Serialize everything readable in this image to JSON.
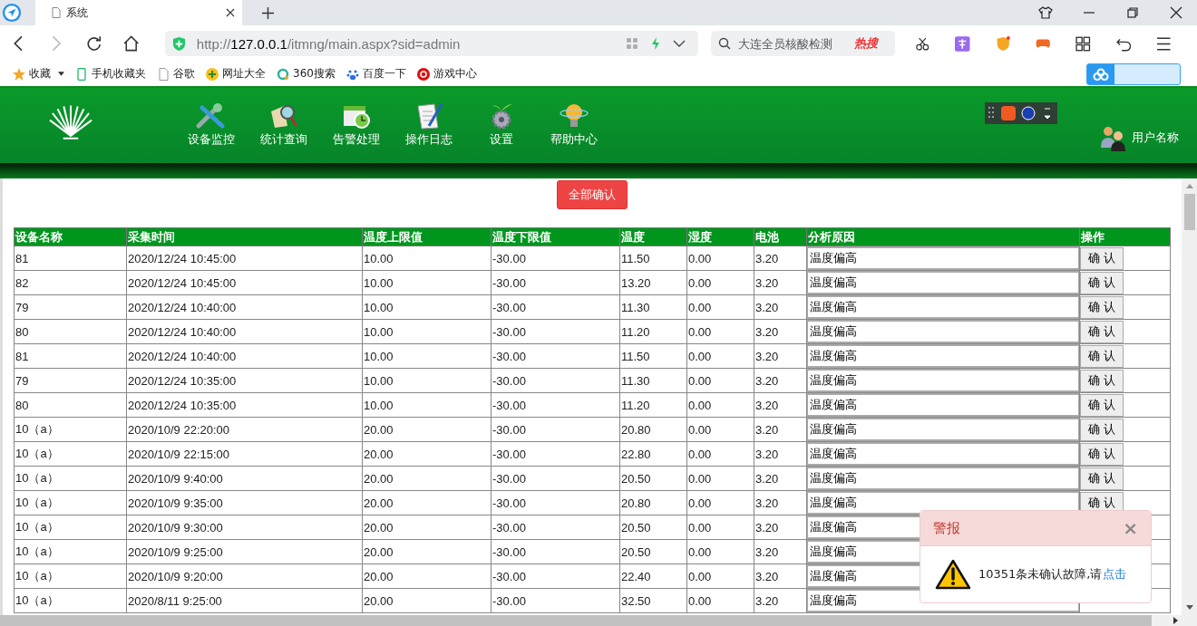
{
  "browser": {
    "tab_title": "系统",
    "url_prefix": "http://",
    "url_host": "127.0.0.1",
    "url_path": "/itmng/main.aspx?sid=admin",
    "search_placeholder": "大连全员核酸检测",
    "hot_label": "热搜",
    "bookmarks": [
      {
        "label": "收藏",
        "kind": "star"
      },
      {
        "label": "手机收藏夹",
        "kind": "phone"
      },
      {
        "label": "谷歌",
        "kind": "page"
      },
      {
        "label": "网址大全",
        "kind": "plus"
      },
      {
        "label": "360搜索",
        "kind": "ring"
      },
      {
        "label": "百度一下",
        "kind": "paw"
      },
      {
        "label": "游戏中心",
        "kind": "game"
      }
    ]
  },
  "header": {
    "nav": [
      {
        "label": "设备监控",
        "kind": "tools"
      },
      {
        "label": "统计查询",
        "kind": "magnifier"
      },
      {
        "label": "告警处理",
        "kind": "calendar"
      },
      {
        "label": "操作日志",
        "kind": "notes"
      },
      {
        "label": "设置",
        "kind": "gear"
      },
      {
        "label": "帮助中心",
        "kind": "bulb"
      }
    ],
    "user": "用户名称"
  },
  "confirm_all": "全部确认",
  "table": {
    "columns": [
      "设备名称",
      "采集时间",
      "温度上限值",
      "温度下限值",
      "温度",
      "湿度",
      "电池",
      "分析原因",
      "操作"
    ],
    "rows": [
      {
        "cells": [
          "81",
          "2020/12/24 10:45:00",
          "10.00",
          "-30.00",
          "11.50",
          "0.00",
          "3.20"
        ],
        "reason": "温度偏高",
        "action": "确 认"
      },
      {
        "cells": [
          "82",
          "2020/12/24 10:45:00",
          "10.00",
          "-30.00",
          "13.20",
          "0.00",
          "3.20"
        ],
        "reason": "温度偏高",
        "action": "确 认"
      },
      {
        "cells": [
          "79",
          "2020/12/24 10:40:00",
          "10.00",
          "-30.00",
          "11.30",
          "0.00",
          "3.20"
        ],
        "reason": "温度偏高",
        "action": "确 认"
      },
      {
        "cells": [
          "80",
          "2020/12/24 10:40:00",
          "10.00",
          "-30.00",
          "11.20",
          "0.00",
          "3.20"
        ],
        "reason": "温度偏高",
        "action": "确 认"
      },
      {
        "cells": [
          "81",
          "2020/12/24 10:40:00",
          "10.00",
          "-30.00",
          "11.50",
          "0.00",
          "3.20"
        ],
        "reason": "温度偏高",
        "action": "确 认"
      },
      {
        "cells": [
          "79",
          "2020/12/24 10:35:00",
          "10.00",
          "-30.00",
          "11.30",
          "0.00",
          "3.20"
        ],
        "reason": "温度偏高",
        "action": "确 认"
      },
      {
        "cells": [
          "80",
          "2020/12/24 10:35:00",
          "10.00",
          "-30.00",
          "11.20",
          "0.00",
          "3.20"
        ],
        "reason": "温度偏高",
        "action": "确 认"
      },
      {
        "cells": [
          "10（a）",
          "2020/10/9 22:20:00",
          "20.00",
          "-30.00",
          "20.80",
          "0.00",
          "3.20"
        ],
        "reason": "温度偏高",
        "action": "确 认"
      },
      {
        "cells": [
          "10（a）",
          "2020/10/9 22:15:00",
          "20.00",
          "-30.00",
          "22.80",
          "0.00",
          "3.20"
        ],
        "reason": "温度偏高",
        "action": "确 认"
      },
      {
        "cells": [
          "10（a）",
          "2020/10/9 9:40:00",
          "20.00",
          "-30.00",
          "20.50",
          "0.00",
          "3.20"
        ],
        "reason": "温度偏高",
        "action": "确 认"
      },
      {
        "cells": [
          "10（a）",
          "2020/10/9 9:35:00",
          "20.00",
          "-30.00",
          "20.80",
          "0.00",
          "3.20"
        ],
        "reason": "温度偏高",
        "action": "确 认"
      },
      {
        "cells": [
          "10（a）",
          "2020/10/9 9:30:00",
          "20.00",
          "-30.00",
          "20.50",
          "0.00",
          "3.20"
        ],
        "reason": "温度偏高"
      },
      {
        "cells": [
          "10（a）",
          "2020/10/9 9:25:00",
          "20.00",
          "-30.00",
          "20.50",
          "0.00",
          "3.20"
        ],
        "reason": "温度偏高"
      },
      {
        "cells": [
          "10（a）",
          "2020/10/9 9:20:00",
          "20.00",
          "-30.00",
          "22.40",
          "0.00",
          "3.20"
        ],
        "reason": "温度偏高"
      },
      {
        "cells": [
          "10（a）",
          "2020/8/11 9:25:00",
          "20.00",
          "-30.00",
          "32.50",
          "0.00",
          "3.20"
        ],
        "reason": "温度偏高"
      }
    ]
  },
  "alert": {
    "title": "警报",
    "close": "×",
    "message": "10351条未确认故障,请",
    "link": "点击"
  }
}
